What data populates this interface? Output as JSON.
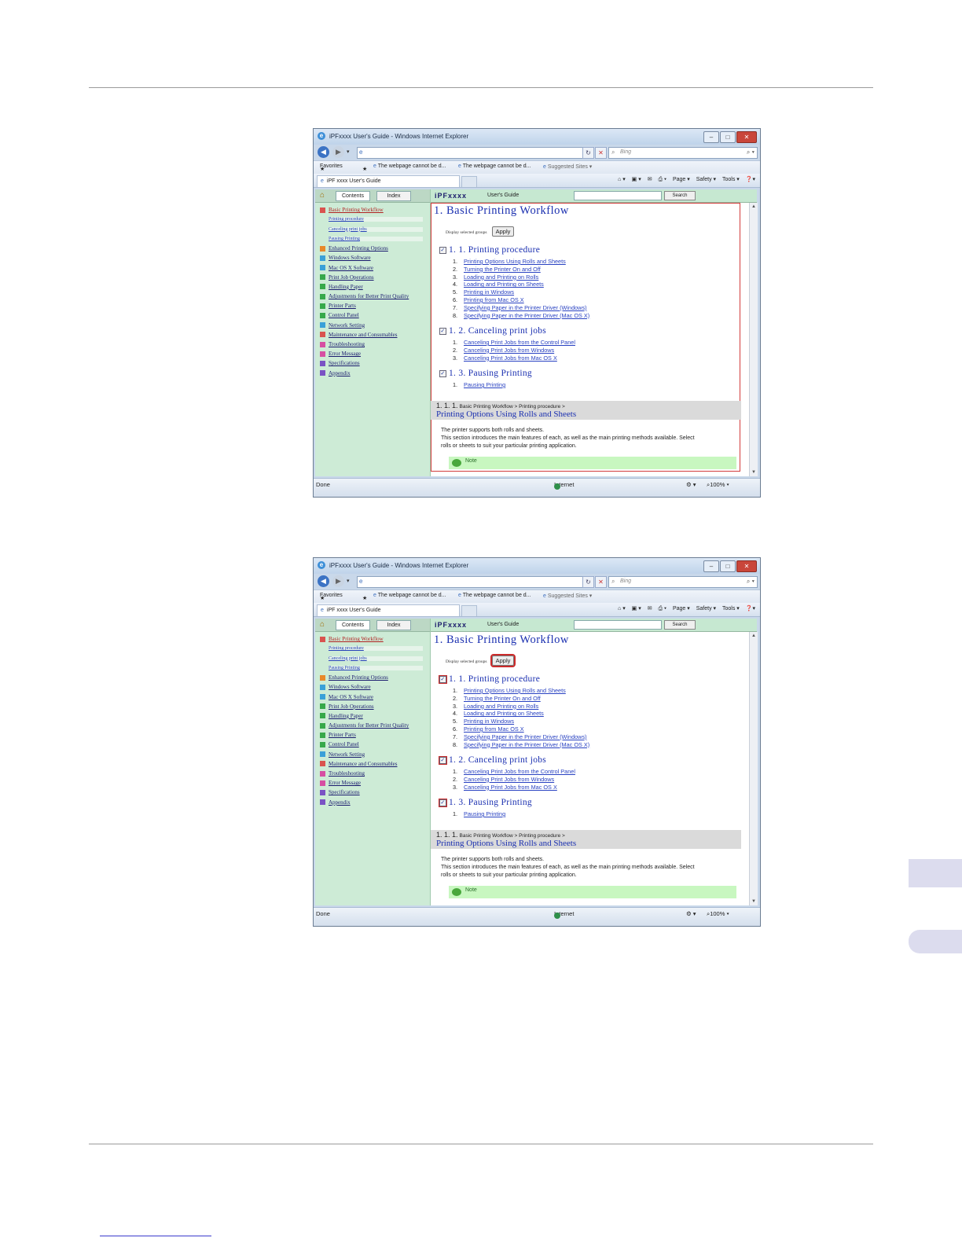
{
  "screenshots": [
    {
      "window_title": "iPFxxxx User's Guide - Windows Internet Explorer",
      "address_value": "",
      "search_placeholder": "Bing",
      "favorites": {
        "label": "Favorites",
        "links": [
          "The webpage cannot be d...",
          "The webpage cannot be d...",
          "Suggested Sites ▾"
        ]
      },
      "page_tab": "iPF xxxx User's Guide",
      "commands": [
        "Page ▾",
        "Safety ▾",
        "Tools ▾"
      ],
      "help_tabs": {
        "contents": "Contents",
        "index": "Index"
      },
      "brand": "iPFxxxx",
      "users_guide": "User's Guide",
      "search_button": "Search",
      "nav": [
        {
          "label": "Basic Printing Workflow",
          "sub": false,
          "color": "#d9534f",
          "selected": true
        },
        {
          "label": "Printing procedure",
          "sub": true
        },
        {
          "label": "Canceling print jobs",
          "sub": true
        },
        {
          "label": "Pausing Printing",
          "sub": true
        },
        {
          "label": "Enhanced Printing Options",
          "sub": false,
          "color": "#e8892b"
        },
        {
          "label": "Windows Software",
          "sub": false,
          "color": "#3aa0d8"
        },
        {
          "label": "Mac OS X Software",
          "sub": false,
          "color": "#3aa0d8"
        },
        {
          "label": "Print Job Operations",
          "sub": false,
          "color": "#37a84a"
        },
        {
          "label": "Handling Paper",
          "sub": false,
          "color": "#37a84a"
        },
        {
          "label": "Adjustments for Better Print Quality",
          "sub": false,
          "color": "#37a84a"
        },
        {
          "label": "Printer Parts",
          "sub": false,
          "color": "#37a84a"
        },
        {
          "label": "Control Panel",
          "sub": false,
          "color": "#37a84a"
        },
        {
          "label": "Network Setting",
          "sub": false,
          "color": "#3aa0d8"
        },
        {
          "label": "Maintenance and Consumables",
          "sub": false,
          "color": "#d9534f"
        },
        {
          "label": "Troubleshooting",
          "sub": false,
          "color": "#d64fa2"
        },
        {
          "label": "Error Message",
          "sub": false,
          "color": "#d64fa2"
        },
        {
          "label": "Specifications",
          "sub": false,
          "color": "#7a52c4"
        },
        {
          "label": "Appendix",
          "sub": false,
          "color": "#7a52c4"
        }
      ],
      "doc_title": "1. Basic Printing Workflow",
      "display_groups_label": "Display selected groups",
      "apply_label": "Apply",
      "sections": [
        {
          "title": "1. 1. Printing procedure",
          "items": [
            {
              "n": "1.",
              "t": "Printing Options Using Rolls and Sheets"
            },
            {
              "n": "2.",
              "t": "Turning the Printer On and Off"
            },
            {
              "n": "3.",
              "t": "Loading and Printing on Rolls"
            },
            {
              "n": "4.",
              "t": "Loading and Printing on Sheets"
            },
            {
              "n": "5.",
              "t": "Printing in Windows"
            },
            {
              "n": "6.",
              "t": "Printing from Mac OS X"
            },
            {
              "n": "7.",
              "t": "Specifying Paper in the Printer Driver (Windows)"
            },
            {
              "n": "8.",
              "t": "Specifying Paper in the Printer Driver (Mac OS X)"
            }
          ]
        },
        {
          "title": "1. 2. Canceling print jobs",
          "items": [
            {
              "n": "1.",
              "t": "Canceling Print Jobs from the Control Panel"
            },
            {
              "n": "2.",
              "t": "Canceling Print Jobs from Windows"
            },
            {
              "n": "3.",
              "t": "Canceling Print Jobs from Mac OS X"
            }
          ]
        },
        {
          "title": "1. 3. Pausing Printing",
          "items": [
            {
              "n": "1.",
              "t": "Pausing Printing"
            }
          ]
        }
      ],
      "crumb_num": "1. 1. 1.",
      "crumb_path": "Basic Printing Workflow > Printing procedure >",
      "subheading": "Printing Options Using Rolls and Sheets",
      "paragraphs": [
        "The printer supports both rolls and sheets.",
        "This section introduces the main features of each, as well as the main printing methods available. Select",
        "rolls or sheets to suit your particular printing application."
      ],
      "note_label": "Note",
      "status_done": "Done",
      "status_zone": "Internet",
      "zoom": "100%"
    },
    {
      "window_title": "iPFxxxx User's Guide - Windows Internet Explorer",
      "address_value": "",
      "search_placeholder": "Bing",
      "favorites": {
        "label": "Favorites",
        "links": [
          "The webpage cannot be d...",
          "The webpage cannot be d...",
          "Suggested Sites ▾"
        ]
      },
      "page_tab": "iPF xxxx User's Guide",
      "commands": [
        "Page ▾",
        "Safety ▾",
        "Tools ▾"
      ],
      "help_tabs": {
        "contents": "Contents",
        "index": "Index"
      },
      "brand": "iPFxxxx",
      "users_guide": "User's Guide",
      "search_button": "Search",
      "nav": [
        {
          "label": "Basic Printing Workflow",
          "sub": false,
          "color": "#d9534f",
          "selected": true
        },
        {
          "label": "Printing procedure",
          "sub": true
        },
        {
          "label": "Canceling print jobs",
          "sub": true
        },
        {
          "label": "Pausing Printing",
          "sub": true
        },
        {
          "label": "Enhanced Printing Options",
          "sub": false,
          "color": "#e8892b"
        },
        {
          "label": "Windows Software",
          "sub": false,
          "color": "#3aa0d8"
        },
        {
          "label": "Mac OS X Software",
          "sub": false,
          "color": "#3aa0d8"
        },
        {
          "label": "Print Job Operations",
          "sub": false,
          "color": "#37a84a"
        },
        {
          "label": "Handling Paper",
          "sub": false,
          "color": "#37a84a"
        },
        {
          "label": "Adjustments for Better Print Quality",
          "sub": false,
          "color": "#37a84a"
        },
        {
          "label": "Printer Parts",
          "sub": false,
          "color": "#37a84a"
        },
        {
          "label": "Control Panel",
          "sub": false,
          "color": "#37a84a"
        },
        {
          "label": "Network Setting",
          "sub": false,
          "color": "#3aa0d8"
        },
        {
          "label": "Maintenance and Consumables",
          "sub": false,
          "color": "#d9534f"
        },
        {
          "label": "Troubleshooting",
          "sub": false,
          "color": "#d64fa2"
        },
        {
          "label": "Error Message",
          "sub": false,
          "color": "#d64fa2"
        },
        {
          "label": "Specifications",
          "sub": false,
          "color": "#7a52c4"
        },
        {
          "label": "Appendix",
          "sub": false,
          "color": "#7a52c4"
        }
      ],
      "doc_title": "1. Basic Printing Workflow",
      "display_groups_label": "Display selected groups",
      "apply_label": "Apply",
      "sections": [
        {
          "title": "1. 1. Printing procedure",
          "items": [
            {
              "n": "1.",
              "t": "Printing Options Using Rolls and Sheets"
            },
            {
              "n": "2.",
              "t": "Turning the Printer On and Off"
            },
            {
              "n": "3.",
              "t": "Loading and Printing on Rolls"
            },
            {
              "n": "4.",
              "t": "Loading and Printing on Sheets"
            },
            {
              "n": "5.",
              "t": "Printing in Windows"
            },
            {
              "n": "6.",
              "t": "Printing from Mac OS X"
            },
            {
              "n": "7.",
              "t": "Specifying Paper in the Printer Driver (Windows)"
            },
            {
              "n": "8.",
              "t": "Specifying Paper in the Printer Driver (Mac OS X)"
            }
          ]
        },
        {
          "title": "1. 2. Canceling print jobs",
          "items": [
            {
              "n": "1.",
              "t": "Canceling Print Jobs from the Control Panel"
            },
            {
              "n": "2.",
              "t": "Canceling Print Jobs from Windows"
            },
            {
              "n": "3.",
              "t": "Canceling Print Jobs from Mac OS X"
            }
          ]
        },
        {
          "title": "1. 3. Pausing Printing",
          "items": [
            {
              "n": "1.",
              "t": "Pausing Printing"
            }
          ]
        }
      ],
      "crumb_num": "1. 1. 1.",
      "crumb_path": "Basic Printing Workflow > Printing procedure >",
      "subheading": "Printing Options Using Rolls and Sheets",
      "paragraphs": [
        "The printer supports both rolls and sheets.",
        "This section introduces the main features of each, as well as the main printing methods available. Select",
        "rolls or sheets to suit your particular printing application."
      ],
      "note_label": "Note",
      "status_done": "Done",
      "status_zone": "Internet",
      "zoom": "100%"
    }
  ]
}
